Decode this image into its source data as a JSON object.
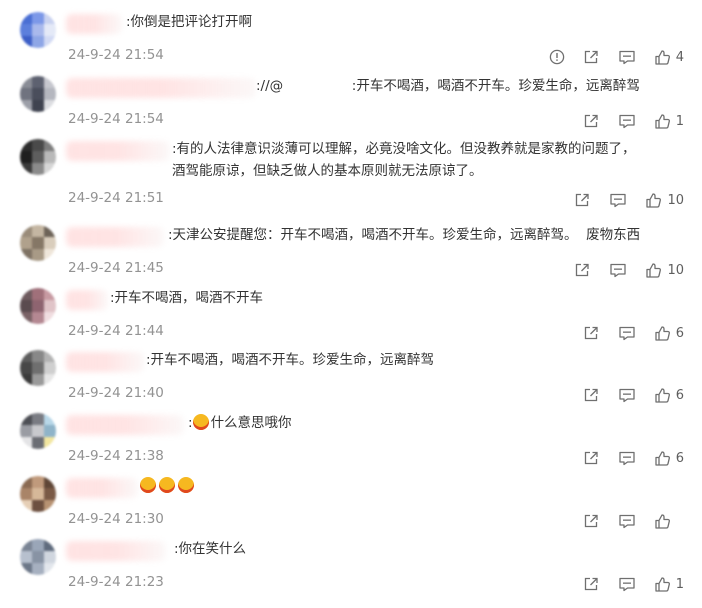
{
  "comments": [
    {
      "text": ":你倒是把评论打开啊",
      "time": "24-9-24 21:54",
      "likes": "4",
      "report": true
    },
    {
      "text": "://@                :开车不喝酒，喝酒不开车。珍爱生命，远离醉驾",
      "time": "24-9-24 21:54",
      "likes": "1",
      "report": false
    },
    {
      "text": ":有的人法律意识淡薄可以理解，必竟没啥文化。但没教养就是家教的问题了，\n酒驾能原谅，但缺乏做人的基本原则就无法原谅了。",
      "time": "24-9-24 21:51",
      "likes": "10",
      "report": false
    },
    {
      "text": ":天津公安提醒您：开车不喝酒，喝酒不开车。珍爱生命，远离醉驾。  废物东西",
      "time": "24-9-24 21:45",
      "likes": "10",
      "report": false
    },
    {
      "text": ":开车不喝酒，喝酒不开车",
      "time": "24-9-24 21:44",
      "likes": "6",
      "report": false
    },
    {
      "text": ":开车不喝酒，喝酒不开车。珍爱生命，远离醉驾",
      "time": "24-9-24 21:40",
      "likes": "6",
      "report": false
    },
    {
      "text": ":什么意思哦你",
      "time": "24-9-24 21:38",
      "likes": "6",
      "report": false
    },
    {
      "text": "",
      "time": "24-9-24 21:30",
      "likes": "",
      "report": false
    },
    {
      "text": ":你在笑什么",
      "time": "24-9-24 21:23",
      "likes": "1",
      "report": false
    }
  ],
  "icons": {
    "report": "report-icon",
    "repost": "repost-icon",
    "comment": "comment-icon",
    "like": "like-icon"
  },
  "colors": {
    "time": "#939393",
    "icon": "#6f6f6f",
    "text": "#333333"
  }
}
